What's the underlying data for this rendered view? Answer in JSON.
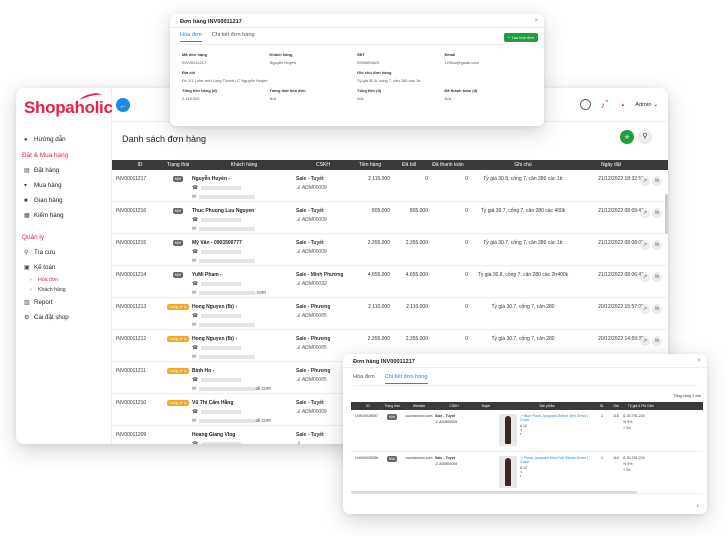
{
  "app": {
    "logo": "Shopaholic",
    "admin_label": "Admin",
    "page_title": "Danh sách đơn hàng",
    "sidebar": {
      "top": [
        {
          "label": "Hướng dẫn",
          "icon": "info-icon"
        }
      ],
      "sec1": "Đặt & Mua hàng",
      "group1": [
        {
          "label": "Đặt hàng",
          "icon": "cart-icon"
        },
        {
          "label": "Mua hàng",
          "icon": "cart-icon"
        },
        {
          "label": "Giao hàng",
          "icon": "truck-icon"
        },
        {
          "label": "Kiểm hàng",
          "icon": "check-icon"
        }
      ],
      "sec2": "Quản lý",
      "group2": [
        {
          "label": "Tra cứu",
          "icon": "search-icon"
        },
        {
          "label": "Kế toán",
          "icon": "accounting-icon"
        }
      ],
      "sub": [
        {
          "label": "Hóa đơn",
          "active": true
        },
        {
          "label": "Khách hàng",
          "active": false
        }
      ],
      "group3": [
        {
          "label": "Report",
          "icon": "report-icon"
        },
        {
          "label": "Cài đặt shop",
          "icon": "gear-icon"
        }
      ]
    },
    "table": {
      "headers": [
        "ID",
        "Trạng thái",
        "Khách hàng",
        "CSKH",
        "Tiền hàng",
        "Đã bill",
        "Đã thanh toán",
        "Ghi chú",
        "Ngày đặt"
      ],
      "rows": [
        {
          "id": "INV00011217",
          "status": "Mới",
          "status_type": "moi",
          "customer": "Nguyễn Huyền -",
          "cskh": "Sale - Tuyết",
          "user": "ADM00009",
          "tien": "2.115.000",
          "dabill": "0",
          "datt": "0",
          "note": "Tỷ giá 30.8, cống 7, cân 280 các 1tr",
          "date": "21/12/2022 18:32:53",
          "email_suffix": ""
        },
        {
          "id": "INV00011216",
          "status": "Mới",
          "status_type": "moi",
          "customer": "Thuc Phuong Luu Nguyen",
          "cskh": "Sale - Tuyết",
          "user": "ADM00009",
          "tien": "805.000",
          "dabill": "805.000",
          "datt": "0",
          "note": "Tỷ giá 30.7, cống 7, cân 280 các 400k",
          "date": "21/12/2022 08:09:46",
          "email_suffix": ""
        },
        {
          "id": "INV00011215",
          "status": "Mới",
          "status_type": "moi",
          "customer": "Mỹ Vân - 0903500777",
          "cskh": "Sale - Tuyết",
          "user": "ADM00009",
          "tien": "2.355.000",
          "dabill": "2.355.000",
          "datt": "0",
          "note": "Tỷ giá 30.7, cống 7, cân 280 các 1tr",
          "date": "21/12/2022 08:08:03",
          "email_suffix": ""
        },
        {
          "id": "INV00011214",
          "status": "Mới",
          "status_type": "moi",
          "customer": "YuMi Pham -",
          "cskh": "Sale - Minh Phương",
          "user": "ADM00032",
          "tien": "4.655.000",
          "dabill": "4.655.000",
          "datt": "0",
          "note": "Tỷ giá 30.8, cống 7, cân 280 các 2tr400k",
          "date": "21/12/2022 08:06:49",
          "email_suffix": ".com"
        },
        {
          "id": "INV00011213",
          "status": "Đang xử lý",
          "status_type": "dang",
          "customer": "Hong Nguyen (fb) -",
          "cskh": "Sale - Phương",
          "user": "ADM00005",
          "tien": "2.110.000",
          "dabill": "2.110.000",
          "datt": "0",
          "note": "Tỷ giá 30.7, cống 7, cân 280",
          "date": "20/12/2022 15:57:08",
          "email_suffix": ""
        },
        {
          "id": "INV00011212",
          "status": "Đang xử lý",
          "status_type": "dang",
          "customer": "Hong Nguyen (fb) -",
          "cskh": "Sale - Phương",
          "user": "ADM00005",
          "tien": "2.355.000",
          "dabill": "2.355.000",
          "datt": "0",
          "note": "Tỷ giá 30.7, cống 7, cân 280",
          "date": "20/12/2022 14:59:35",
          "email_suffix": ""
        },
        {
          "id": "INV00011211",
          "status": "Đang xử lý",
          "status_type": "dang",
          "customer": "Binh Ho -",
          "cskh": "Sale - Phương",
          "user": "ADM00005",
          "tien": "",
          "dabill": "",
          "datt": "",
          "note": "",
          "date": "",
          "email_suffix": "ail.com"
        },
        {
          "id": "INV00011210",
          "status": "Đang xử lý",
          "status_type": "dang",
          "customer": "Vũ Thị Cẩm Hằng",
          "cskh": "Sale - Tuyết",
          "user": "ADM00009",
          "tien": "",
          "dabill": "",
          "datt": "",
          "note": "",
          "date": "",
          "email_suffix": "ail.com"
        },
        {
          "id": "INV00011209",
          "status": "",
          "status_type": "none",
          "customer": "Hoang Giang Vlog",
          "cskh": "Sale - Tuyết",
          "user": "",
          "tien": "",
          "dabill": "",
          "datt": "",
          "note": "",
          "date": "",
          "email_suffix": ""
        }
      ]
    }
  },
  "modal1": {
    "title": "Đơn hàng INV00011217",
    "tabs": [
      "Hóa đơn",
      "Chi tiết đơn hàng"
    ],
    "button": "+ Tạo hóa đơn",
    "fields": [
      {
        "label": "Mã đơn hàng",
        "value": "INV00011217"
      },
      {
        "label": "Khách hàng",
        "value": "Nguyễn Huyền"
      },
      {
        "label": "SĐT",
        "value": "0906659625"
      },
      {
        "label": "Email",
        "value": "123hai@gmail.com"
      },
      {
        "label": "Địa chỉ",
        "value": "Đc 2/1 | chợ mới Long Thành | C Nguyễn Huyền"
      },
      {
        "label": "Ghi chú đơn hàng",
        "value": "Tỷ giá 30.8, cống 7, cân 280 các 1tr"
      },
      {
        "label": "Tổng tiền hàng (đ)",
        "value": "2.115.000"
      },
      {
        "label": "Trạng thái hóa đơn",
        "value": "N/A"
      },
      {
        "label": "Tổng tiền (đ)",
        "value": "N/A"
      },
      {
        "label": "Đã thanh toán (đ)",
        "value": "N/A"
      }
    ]
  },
  "modal2": {
    "title": "Đơn hàng INV00011217",
    "tabs": [
      "Hóa đơn",
      "Chi tiết đơn hàng"
    ],
    "total_label": "Tổng cộng 2 link",
    "headers": [
      "ID",
      "Trạng thái",
      "Website",
      "CSKH",
      "Buyer",
      "Sản phẩm",
      "SL",
      "Giá",
      "Tỷ giá & Phí Dịch"
    ],
    "rows": [
      {
        "id": "LNK00026057",
        "status": "Mới",
        "website": "cozofashion.com",
        "cskh": "Sale - Tuyết",
        "user": "ADM00009",
        "product": "Blue Floral Jacquard Belted Mini Dress | Cozzi",
        "size": "12",
        "sl": "1",
        "gia": "115",
        "rate": "30,791,224",
        "pct": "5%",
        "fee": "Số"
      },
      {
        "id": "LNK00026056",
        "status": "Mới",
        "website": "cozofashion.com",
        "cskh": "Sale - Tuyết",
        "user": "ADM00009",
        "product": "Floral Jacquard Mini Puff Sleeve Dress | Cozzi",
        "size": "12",
        "sl": "1",
        "gia": "110",
        "rate": "30,791,224",
        "pct": "5%",
        "fee": "Số"
      }
    ],
    "page": "1"
  }
}
